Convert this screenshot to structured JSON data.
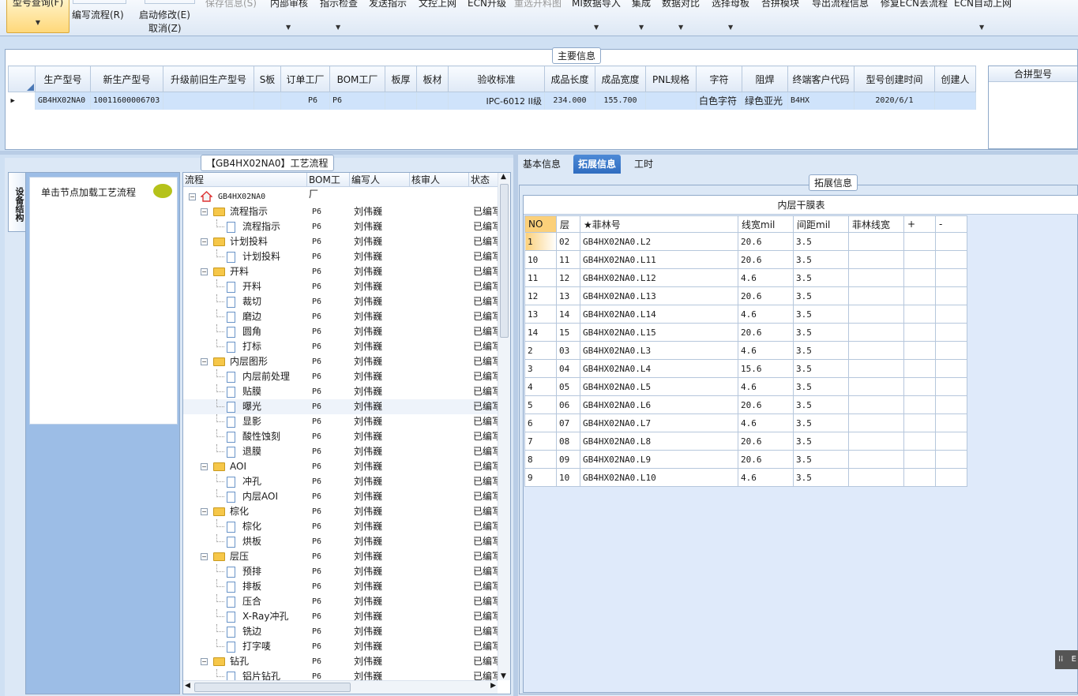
{
  "ribbon": {
    "items": [
      {
        "label": "型号查询(F)",
        "state": "active"
      },
      {
        "label": "编写流程(R)"
      },
      {
        "label": "启动修改(E)"
      },
      {
        "label": "取消(Z)"
      },
      {
        "label": "保存信息(S)",
        "state": "disabled"
      },
      {
        "label": "内部审核"
      },
      {
        "label": "指示检查"
      },
      {
        "label": "发送指示"
      },
      {
        "label": "文控上网"
      },
      {
        "label": "ECN升级"
      },
      {
        "label": "重选开料图",
        "state": "disabled"
      },
      {
        "label": "MI数据导入"
      },
      {
        "label": "集成"
      },
      {
        "label": "数据对比"
      },
      {
        "label": "选择母板"
      },
      {
        "label": "合拼模块"
      },
      {
        "label": "导出流程信息"
      },
      {
        "label": "修复ECN丢流程"
      },
      {
        "label": "ECN自动上网"
      }
    ]
  },
  "main_info": {
    "caption": "主要信息",
    "columns": [
      "生产型号",
      "新生产型号",
      "升级前旧生产型号",
      "S板",
      "订单工厂",
      "BOM工厂",
      "板厚",
      "板材",
      "验收标准",
      "成品长度",
      "成品宽度",
      "PNL规格",
      "字符",
      "阻焊",
      "终端客户代码",
      "型号创建时间",
      "创建人"
    ],
    "row": [
      "GB4HX02NA0",
      "10011600006703",
      "",
      "",
      "P6",
      "P6",
      "",
      "",
      "IPC-6012 II级",
      "234.000",
      "155.700",
      "",
      "白色字符",
      "绿色亚光",
      "B4HX",
      "2020/6/1",
      ""
    ],
    "merge_header": "合拼型号"
  },
  "left_panel": {
    "caption": "【GB4HX02NA0】工艺流程",
    "vertical_tab": "设备结构",
    "hint": "单击节点加载工艺流程"
  },
  "tree": {
    "headers": [
      "流程",
      "BOM工厂",
      "编写人",
      "核审人",
      "状态"
    ],
    "root": "GB4HX02NA0",
    "rows": [
      {
        "name": "流程指示",
        "level": 1,
        "bom": "P6",
        "writer": "刘伟巍",
        "status": "已编写"
      },
      {
        "name": "流程指示",
        "level": 2,
        "bom": "P6",
        "writer": "刘伟巍",
        "status": "已编写"
      },
      {
        "name": "计划投料",
        "level": 1,
        "bom": "P6",
        "writer": "刘伟巍",
        "status": "已编写"
      },
      {
        "name": "计划投料",
        "level": 2,
        "bom": "P6",
        "writer": "刘伟巍",
        "status": "已编写"
      },
      {
        "name": "开料",
        "level": 1,
        "bom": "P6",
        "writer": "刘伟巍",
        "status": "已编写"
      },
      {
        "name": "开料",
        "level": 2,
        "bom": "P6",
        "writer": "刘伟巍",
        "status": "已编写"
      },
      {
        "name": "裁切",
        "level": 2,
        "bom": "P6",
        "writer": "刘伟巍",
        "status": "已编写"
      },
      {
        "name": "磨边",
        "level": 2,
        "bom": "P6",
        "writer": "刘伟巍",
        "status": "已编写"
      },
      {
        "name": "圆角",
        "level": 2,
        "bom": "P6",
        "writer": "刘伟巍",
        "status": "已编写"
      },
      {
        "name": "打标",
        "level": 2,
        "bom": "P6",
        "writer": "刘伟巍",
        "status": "已编写"
      },
      {
        "name": "内层图形",
        "level": 1,
        "bom": "P6",
        "writer": "刘伟巍",
        "status": "已编写"
      },
      {
        "name": "内层前处理",
        "level": 2,
        "bom": "P6",
        "writer": "刘伟巍",
        "status": "已编写"
      },
      {
        "name": "贴膜",
        "level": 2,
        "bom": "P6",
        "writer": "刘伟巍",
        "status": "已编写"
      },
      {
        "name": "曝光",
        "level": 2,
        "bom": "P6",
        "writer": "刘伟巍",
        "status": "已编写",
        "selected": true
      },
      {
        "name": "显影",
        "level": 2,
        "bom": "P6",
        "writer": "刘伟巍",
        "status": "已编写"
      },
      {
        "name": "酸性蚀刻",
        "level": 2,
        "bom": "P6",
        "writer": "刘伟巍",
        "status": "已编写"
      },
      {
        "name": "退膜",
        "level": 2,
        "bom": "P6",
        "writer": "刘伟巍",
        "status": "已编写"
      },
      {
        "name": "AOI",
        "level": 1,
        "bom": "P6",
        "writer": "刘伟巍",
        "status": "已编写"
      },
      {
        "name": "冲孔",
        "level": 2,
        "bom": "P6",
        "writer": "刘伟巍",
        "status": "已编写"
      },
      {
        "name": "内层AOI",
        "level": 2,
        "bom": "P6",
        "writer": "刘伟巍",
        "status": "已编写"
      },
      {
        "name": "棕化",
        "level": 1,
        "bom": "P6",
        "writer": "刘伟巍",
        "status": "已编写"
      },
      {
        "name": "棕化",
        "level": 2,
        "bom": "P6",
        "writer": "刘伟巍",
        "status": "已编写"
      },
      {
        "name": "烘板",
        "level": 2,
        "bom": "P6",
        "writer": "刘伟巍",
        "status": "已编写"
      },
      {
        "name": "层压",
        "level": 1,
        "bom": "P6",
        "writer": "刘伟巍",
        "status": "已编写"
      },
      {
        "name": "预排",
        "level": 2,
        "bom": "P6",
        "writer": "刘伟巍",
        "status": "已编写"
      },
      {
        "name": "排板",
        "level": 2,
        "bom": "P6",
        "writer": "刘伟巍",
        "status": "已编写"
      },
      {
        "name": "压合",
        "level": 2,
        "bom": "P6",
        "writer": "刘伟巍",
        "status": "已编写"
      },
      {
        "name": "X-Ray冲孔",
        "level": 2,
        "bom": "P6",
        "writer": "刘伟巍",
        "status": "已编写"
      },
      {
        "name": "铣边",
        "level": 2,
        "bom": "P6",
        "writer": "刘伟巍",
        "status": "已编写"
      },
      {
        "name": "打字唛",
        "level": 2,
        "bom": "P6",
        "writer": "刘伟巍",
        "status": "已编写"
      },
      {
        "name": "钻孔",
        "level": 1,
        "bom": "P6",
        "writer": "刘伟巍",
        "status": "已编写"
      },
      {
        "name": "铝片钻孔",
        "level": 2,
        "bom": "P6",
        "writer": "刘伟巍",
        "status": "已编写"
      }
    ]
  },
  "right_panel": {
    "tabs": [
      {
        "label": "基本信息"
      },
      {
        "label": "拓展信息",
        "active": true
      },
      {
        "label": "工时"
      }
    ],
    "caption": "拓展信息",
    "grid_title": "内层干膜表",
    "columns": [
      "NO",
      "层",
      "★菲林号",
      "线宽mil",
      "间距mil",
      "菲林线宽",
      "+",
      "-"
    ],
    "rows": [
      [
        "1",
        "02",
        "GB4HX02NA0.L2",
        "20.6",
        "3.5"
      ],
      [
        "10",
        "11",
        "GB4HX02NA0.L11",
        "20.6",
        "3.5"
      ],
      [
        "11",
        "12",
        "GB4HX02NA0.L12",
        "4.6",
        "3.5"
      ],
      [
        "12",
        "13",
        "GB4HX02NA0.L13",
        "20.6",
        "3.5"
      ],
      [
        "13",
        "14",
        "GB4HX02NA0.L14",
        "4.6",
        "3.5"
      ],
      [
        "14",
        "15",
        "GB4HX02NA0.L15",
        "20.6",
        "3.5"
      ],
      [
        "2",
        "03",
        "GB4HX02NA0.L3",
        "4.6",
        "3.5"
      ],
      [
        "3",
        "04",
        "GB4HX02NA0.L4",
        "15.6",
        "3.5"
      ],
      [
        "4",
        "05",
        "GB4HX02NA0.L5",
        "4.6",
        "3.5"
      ],
      [
        "5",
        "06",
        "GB4HX02NA0.L6",
        "20.6",
        "3.5"
      ],
      [
        "6",
        "07",
        "GB4HX02NA0.L7",
        "4.6",
        "3.5"
      ],
      [
        "7",
        "08",
        "GB4HX02NA0.L8",
        "20.6",
        "3.5"
      ],
      [
        "8",
        "09",
        "GB4HX02NA0.L9",
        "20.6",
        "3.5"
      ],
      [
        "9",
        "10",
        "GB4HX02NA0.L10",
        "4.6",
        "3.5"
      ]
    ],
    "corner_text": "E"
  },
  "colors": {
    "selected_tab": "#2f6cc0",
    "row_highlight": "#cfe3fb",
    "no_header": "#fbd07a"
  }
}
